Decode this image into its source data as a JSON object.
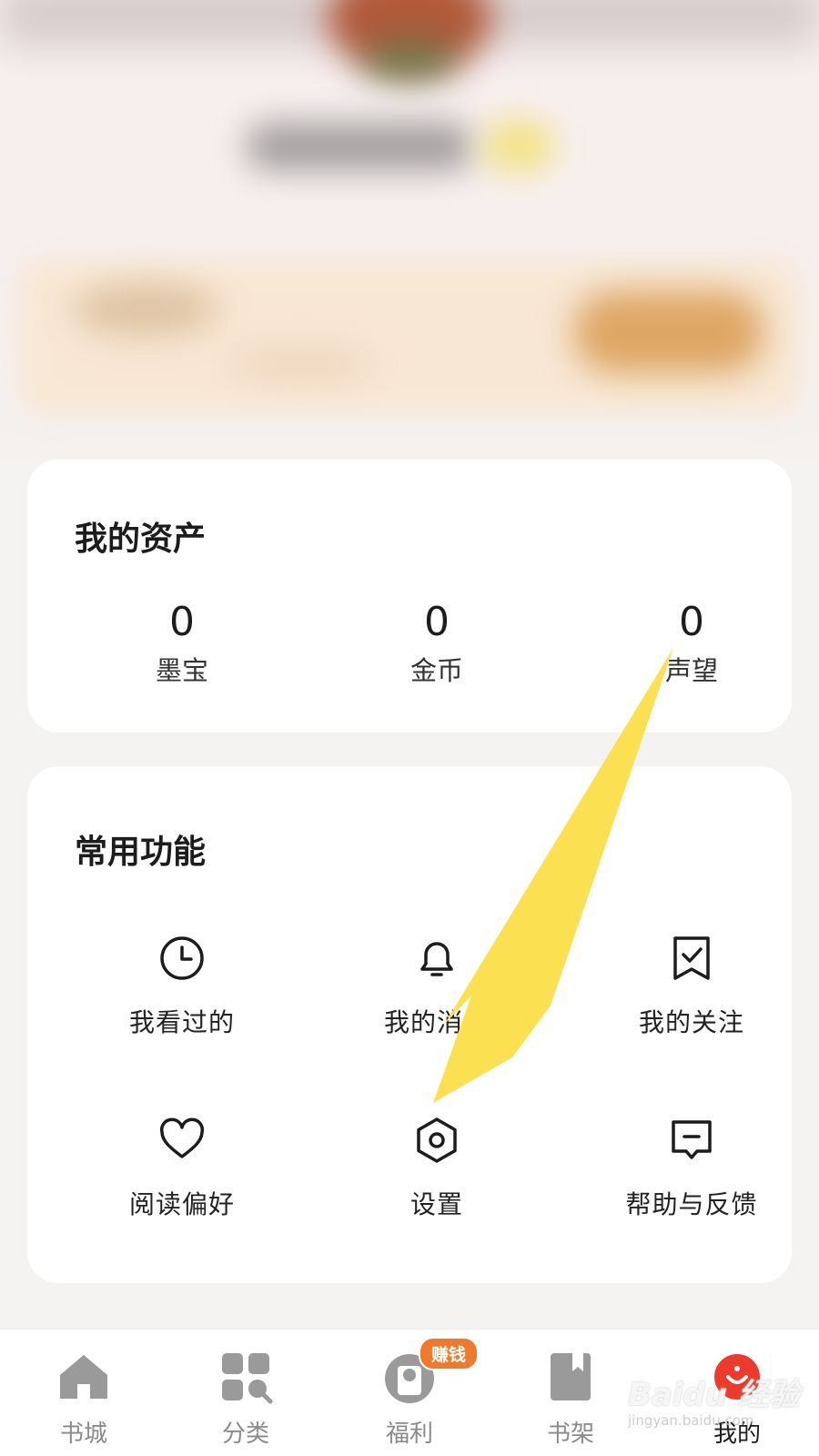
{
  "assets": {
    "title": "我的资产",
    "items": [
      {
        "value": "0",
        "label": "墨宝"
      },
      {
        "value": "0",
        "label": "金币"
      },
      {
        "value": "0",
        "label": "声望"
      }
    ]
  },
  "functions": {
    "title": "常用功能",
    "items": [
      {
        "label": "我看过的",
        "icon": "clock-icon"
      },
      {
        "label": "我的消息",
        "icon": "bell-icon"
      },
      {
        "label": "我的关注",
        "icon": "bookmark-check-icon"
      },
      {
        "label": "阅读偏好",
        "icon": "heart-icon"
      },
      {
        "label": "设置",
        "icon": "settings-hexagon-icon"
      },
      {
        "label": "帮助与反馈",
        "icon": "feedback-message-icon"
      }
    ]
  },
  "bottom_nav": {
    "items": [
      {
        "label": "书城",
        "icon": "home-icon"
      },
      {
        "label": "分类",
        "icon": "category-grid-icon"
      },
      {
        "label": "福利",
        "icon": "welfare-icon"
      },
      {
        "label": "书架",
        "icon": "bookshelf-icon"
      },
      {
        "label": "我的",
        "icon": "profile-icon"
      }
    ],
    "active": "我的",
    "earn_badge": "赚钱"
  },
  "annotation": {
    "color": "#fbe052"
  },
  "watermark": {
    "brand": "Baidu 经验",
    "url": "jingyan.baidu.com"
  }
}
